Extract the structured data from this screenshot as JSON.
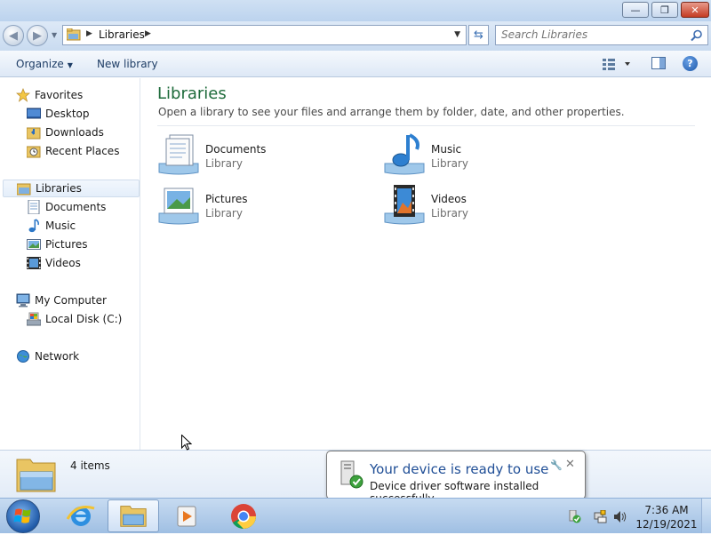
{
  "window": {
    "minimize_icon": "minimize-icon",
    "maximize_icon": "restore-icon",
    "close_icon": "close-icon"
  },
  "address_bar": {
    "path": "Libraries",
    "search_placeholder": "Search Libraries"
  },
  "command_bar": {
    "organize": "Organize",
    "new_library": "New library"
  },
  "nav_pane": {
    "favorites": {
      "label": "Favorites",
      "items": [
        {
          "label": "Desktop"
        },
        {
          "label": "Downloads"
        },
        {
          "label": "Recent Places"
        }
      ]
    },
    "libraries": {
      "label": "Libraries",
      "items": [
        {
          "label": "Documents"
        },
        {
          "label": "Music"
        },
        {
          "label": "Pictures"
        },
        {
          "label": "Videos"
        }
      ]
    },
    "computer": {
      "label": "My Computer",
      "items": [
        {
          "label": "Local Disk (C:)"
        }
      ]
    },
    "network": {
      "label": "Network"
    }
  },
  "content": {
    "title": "Libraries",
    "description": "Open a library to see your files and arrange them by folder, date, and other properties.",
    "libraries": [
      {
        "name": "Documents",
        "type": "Library",
        "icon": "documents-library-icon"
      },
      {
        "name": "Music",
        "type": "Library",
        "icon": "music-library-icon"
      },
      {
        "name": "Pictures",
        "type": "Library",
        "icon": "pictures-library-icon"
      },
      {
        "name": "Videos",
        "type": "Library",
        "icon": "videos-library-icon"
      }
    ]
  },
  "details_pane": {
    "item_count": "4 items"
  },
  "notification": {
    "title": "Your device is ready to use",
    "message": "Device driver software installed successfully."
  },
  "taskbar": {
    "apps": [
      "internet-explorer-icon",
      "windows-explorer-icon",
      "media-player-icon",
      "chrome-icon"
    ],
    "clock_time": "7:36 AM",
    "clock_date": "12/19/2021"
  },
  "colors": {
    "title_green": "#1e6b3b",
    "link_blue": "#1e3d66",
    "balloon_title": "#1f4e96"
  }
}
